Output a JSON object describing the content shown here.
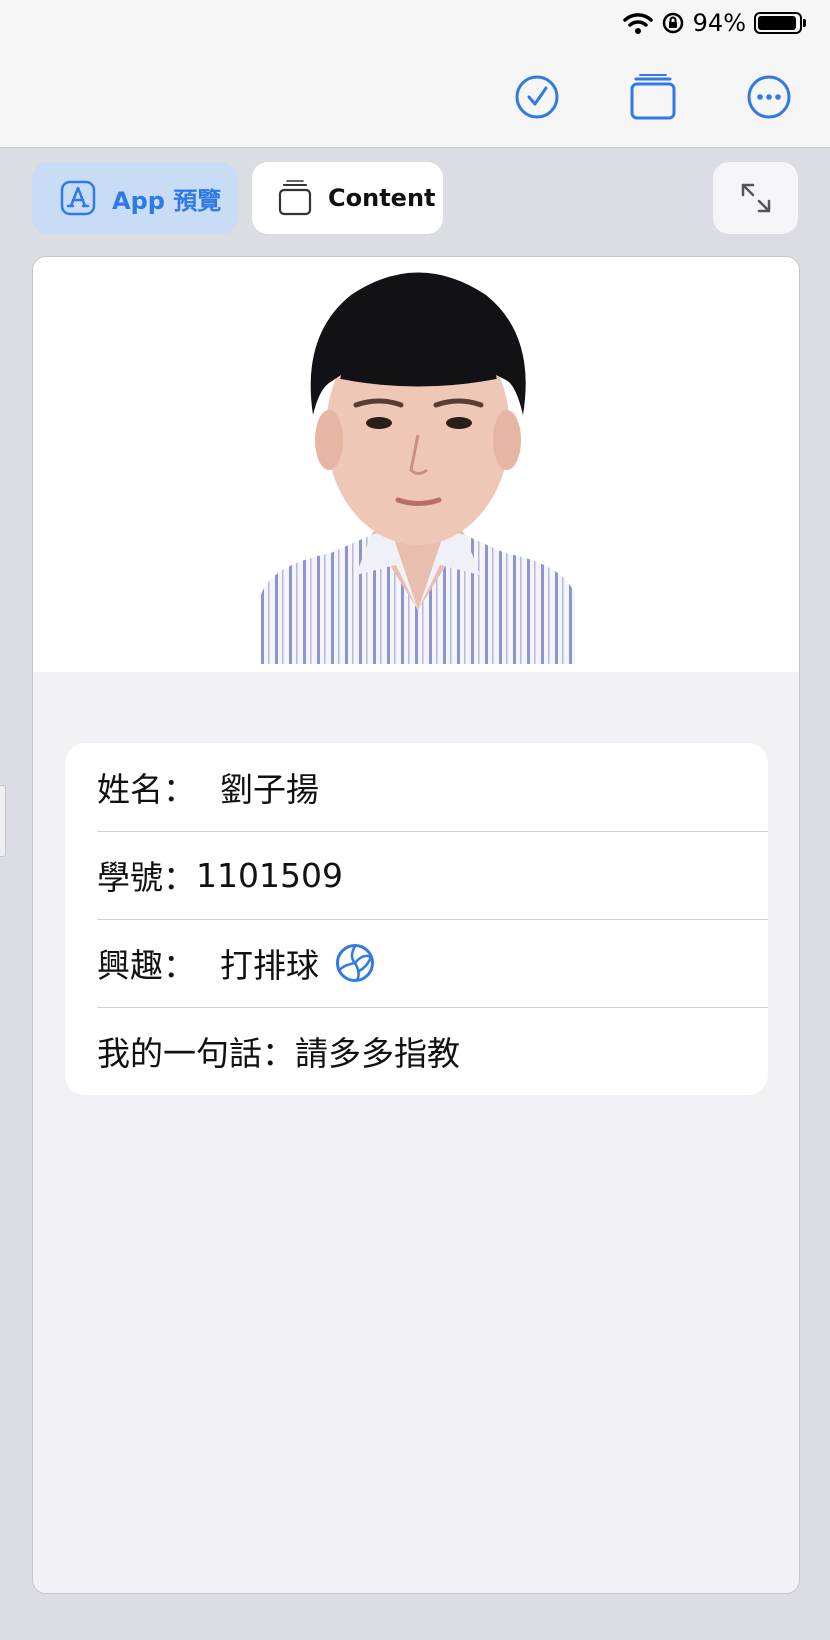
{
  "status_bar": {
    "battery": "94%",
    "battery_level": 0.94
  },
  "tabs": {
    "app_preview": "App 預覽",
    "content": "Content"
  },
  "profile": {
    "rows": [
      {
        "label": "姓名：",
        "value": "劉子揚"
      },
      {
        "label": "學號：",
        "value": "1101509"
      },
      {
        "label": "興趣：",
        "value": "打排球"
      },
      {
        "label": "我的一句話：",
        "value": "請多多指教"
      }
    ]
  },
  "colors": {
    "accent": "#2f7ae5",
    "tab_selected_bg": "#c9dcf6"
  }
}
